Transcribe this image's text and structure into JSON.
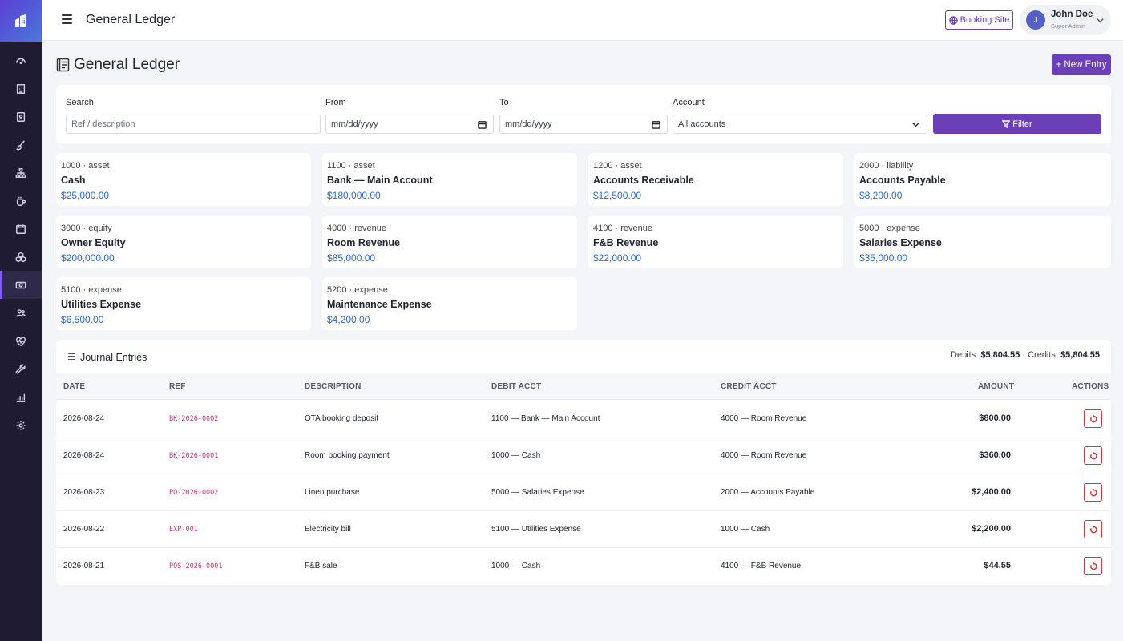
{
  "sidebar": {
    "logo_icon": "hotel-building-icon",
    "items": [
      {
        "icon": "dashboard-gauge-icon"
      },
      {
        "icon": "building-icon"
      },
      {
        "icon": "contact-book-icon"
      },
      {
        "icon": "brush-icon"
      },
      {
        "icon": "org-chart-icon"
      },
      {
        "icon": "coffee-cup-icon"
      },
      {
        "icon": "calendar-icon"
      },
      {
        "icon": "boxes-icon"
      },
      {
        "icon": "cash-icon",
        "active": true
      },
      {
        "icon": "users-icon"
      },
      {
        "icon": "heart-pulse-icon"
      },
      {
        "icon": "wrench-icon"
      },
      {
        "icon": "bar-chart-icon"
      },
      {
        "icon": "gear-icon"
      }
    ]
  },
  "topbar": {
    "title": "General Ledger",
    "booking_site": "Booking Site",
    "user": {
      "initial": "J",
      "name": "John Doe",
      "role": "Super Admin"
    }
  },
  "page": {
    "title": "General Ledger",
    "new_entry": "+ New Entry"
  },
  "filters": {
    "search_label": "Search",
    "search_placeholder": "Ref / description",
    "from_label": "From",
    "from_value": "mm/dd/yyyy",
    "to_label": "To",
    "to_value": "mm/dd/yyyy",
    "account_label": "Account",
    "account_value": "All accounts",
    "filter_button": "Filter"
  },
  "accounts": [
    {
      "meta": "1000 · asset",
      "name": "Cash",
      "balance": "$25,000.00"
    },
    {
      "meta": "1100 · asset",
      "name": "Bank — Main Account",
      "balance": "$180,000.00"
    },
    {
      "meta": "1200 · asset",
      "name": "Accounts Receivable",
      "balance": "$12,500.00"
    },
    {
      "meta": "2000 · liability",
      "name": "Accounts Payable",
      "balance": "$8,200.00"
    },
    {
      "meta": "3000 · equity",
      "name": "Owner Equity",
      "balance": "$200,000.00"
    },
    {
      "meta": "4000 · revenue",
      "name": "Room Revenue",
      "balance": "$85,000.00"
    },
    {
      "meta": "4100 · revenue",
      "name": "F&B Revenue",
      "balance": "$22,000.00"
    },
    {
      "meta": "5000 · expense",
      "name": "Salaries Expense",
      "balance": "$35,000.00"
    },
    {
      "meta": "5100 · expense",
      "name": "Utilities Expense",
      "balance": "$6,500.00"
    },
    {
      "meta": "5200 · expense",
      "name": "Maintenance Expense",
      "balance": "$4,200.00"
    }
  ],
  "journal": {
    "title": "Journal Entries",
    "debits_label": "Debits:",
    "debits_value": "$5,804.55",
    "separator": "·",
    "credits_label": "Credits:",
    "credits_value": "$5,804.55",
    "columns": [
      "DATE",
      "REF",
      "DESCRIPTION",
      "DEBIT ACCT",
      "CREDIT ACCT",
      "AMOUNT",
      "ACTIONS"
    ],
    "rows": [
      {
        "date": "2026-08-24",
        "ref": "BK-2026-0002",
        "description": "OTA booking deposit",
        "debit": "1100 — Bank — Main Account",
        "credit": "4000 — Room Revenue",
        "amount": "$800.00"
      },
      {
        "date": "2026-08-24",
        "ref": "BK-2026-0001",
        "description": "Room booking payment",
        "debit": "1000 — Cash",
        "credit": "4000 — Room Revenue",
        "amount": "$360.00"
      },
      {
        "date": "2026-08-23",
        "ref": "PO-2026-0002",
        "description": "Linen purchase",
        "debit": "5000 — Salaries Expense",
        "credit": "2000 — Accounts Payable",
        "amount": "$2,400.00"
      },
      {
        "date": "2026-08-22",
        "ref": "EXP-001",
        "description": "Electricity bill",
        "debit": "5100 — Utilities Expense",
        "credit": "1000 — Cash",
        "amount": "$2,200.00"
      },
      {
        "date": "2026-08-21",
        "ref": "POS-2026-0001",
        "description": "F&B sale",
        "debit": "1000 — Cash",
        "credit": "4100 — F&B Revenue",
        "amount": "$44.55"
      }
    ]
  },
  "colors": {
    "accent": "#6a3fb8",
    "sidebar": "#1e1b33",
    "balance": "#2f6bd1",
    "ref": "#c23a7a",
    "danger": "#d9343e"
  }
}
